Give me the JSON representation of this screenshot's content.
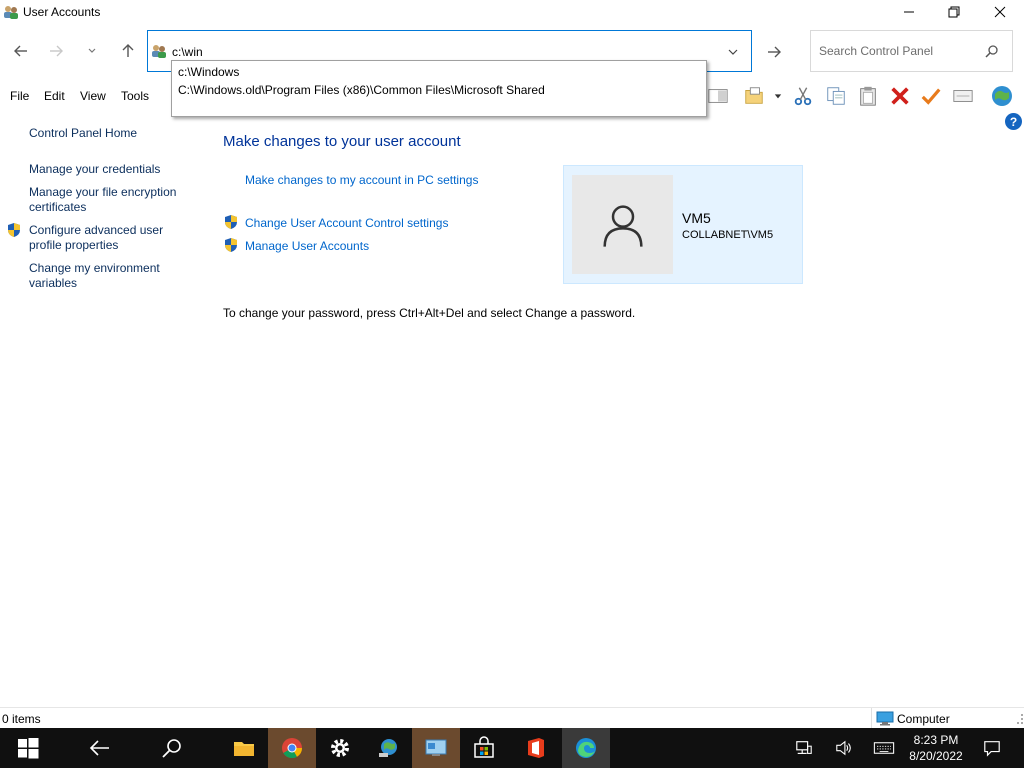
{
  "window": {
    "title": "User Accounts"
  },
  "address": {
    "value": "c:\\win",
    "suggestions": [
      "c:\\Windows",
      "C:\\Windows.old\\Program Files (x86)\\Common Files\\Microsoft Shared"
    ]
  },
  "search": {
    "placeholder": "Search Control Panel"
  },
  "menu": {
    "file": "File",
    "edit": "Edit",
    "view": "View",
    "tools": "Tools"
  },
  "left_pane": {
    "home": "Control Panel Home",
    "credentials": "Manage your credentials",
    "encryption": "Manage your file encryption certificates",
    "advanced": "Configure advanced user profile properties",
    "environment": "Change my environment variables"
  },
  "main": {
    "title": "Make changes to your user account",
    "pc_settings_link": "Make changes to my account in PC settings",
    "uac_link": "Change User Account Control settings",
    "manage_link": "Manage User Accounts",
    "password_note": "To change your password, press Ctrl+Alt+Del and select Change a password."
  },
  "user": {
    "name": "VM5",
    "domain": "COLLABNET\\VM5"
  },
  "status": {
    "items": "0 items",
    "location": "Computer"
  },
  "taskbar": {
    "time": "8:23 PM",
    "date": "8/20/2022"
  },
  "colors": {
    "accent": "#0078d7",
    "link": "#0066cc",
    "heading": "#003399",
    "tile_bg": "#e5f3ff",
    "taskbar": "#101010"
  }
}
